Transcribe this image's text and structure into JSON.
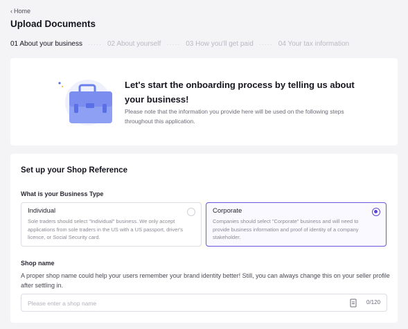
{
  "nav": {
    "back_label": "Home"
  },
  "header": {
    "title": "Upload Documents"
  },
  "steps": [
    {
      "label": "01 About your business",
      "active": true
    },
    {
      "label": "02 About yourself",
      "active": false
    },
    {
      "label": "03 How you'll get paid",
      "active": false
    },
    {
      "label": "04 Your tax information",
      "active": false
    }
  ],
  "step_separator": "·····",
  "intro": {
    "heading": "Let's start the onboarding process by telling us about your business!",
    "note": "Please note that the information you provide here will be used on the following steps throughout this application.",
    "illustration_icon": "briefcase-icon"
  },
  "shop_reference": {
    "title": "Set up your Shop Reference",
    "business_type_label": "What is your Business Type",
    "options": [
      {
        "title": "Individual",
        "description": "Sole traders should select \"Individual\" business. We only accept applications from sole traders in the US with a US passport, driver's licence, or Social Security card.",
        "selected": false
      },
      {
        "title": "Corporate",
        "description": "Companies should select \"Corporate\" business and will need to provide business information and proof of identity of a company stakeholder.",
        "selected": true
      }
    ],
    "shop_name_label": "Shop name",
    "shop_name_help": "A proper shop name could help your users remember your brand identity better! Still, you can always change this on your seller profile after settling in.",
    "shop_name_placeholder": "Please enter a shop name",
    "shop_name_value": "",
    "shop_name_counter": "0/120"
  },
  "colors": {
    "accent": "#5b47d6",
    "page_bg": "#f4f4f6",
    "card_bg": "#ffffff",
    "briefcase": "#7b8ef0"
  }
}
